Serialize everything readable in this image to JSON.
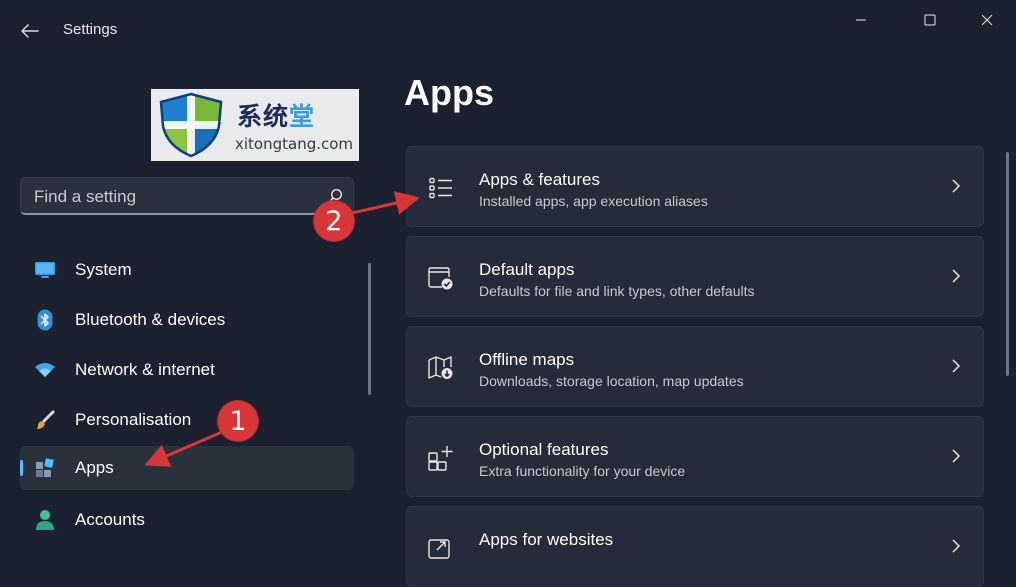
{
  "window": {
    "title": "Settings"
  },
  "watermark": {
    "line1_dark": "系统",
    "line1_blue": "堂",
    "line2": "xitongtang.com"
  },
  "search": {
    "placeholder": "Find a setting"
  },
  "sidebar": {
    "items": [
      {
        "label": "System",
        "icon": "monitor-icon"
      },
      {
        "label": "Bluetooth & devices",
        "icon": "bluetooth-icon"
      },
      {
        "label": "Network & internet",
        "icon": "wifi-icon"
      },
      {
        "label": "Personalisation",
        "icon": "paintbrush-icon"
      },
      {
        "label": "Apps",
        "icon": "apps-icon",
        "selected": true
      },
      {
        "label": "Accounts",
        "icon": "person-icon"
      }
    ]
  },
  "main": {
    "page_title": "Apps",
    "cards": [
      {
        "title": "Apps & features",
        "subtitle": "Installed apps, app execution aliases",
        "icon": "list-icon"
      },
      {
        "title": "Default apps",
        "subtitle": "Defaults for file and link types, other defaults",
        "icon": "default-apps-icon"
      },
      {
        "title": "Offline maps",
        "subtitle": "Downloads, storage location, map updates",
        "icon": "map-icon"
      },
      {
        "title": "Optional features",
        "subtitle": "Extra functionality for your device",
        "icon": "add-feature-icon"
      },
      {
        "title": "Apps for websites",
        "subtitle": "",
        "icon": "link-app-icon"
      }
    ]
  },
  "annotations": {
    "badge_1": "1",
    "badge_2": "2"
  },
  "colors": {
    "background": "#1c2130",
    "card": "#252b38",
    "accent": "#4cc2ff",
    "annotation": "#d9363a"
  }
}
